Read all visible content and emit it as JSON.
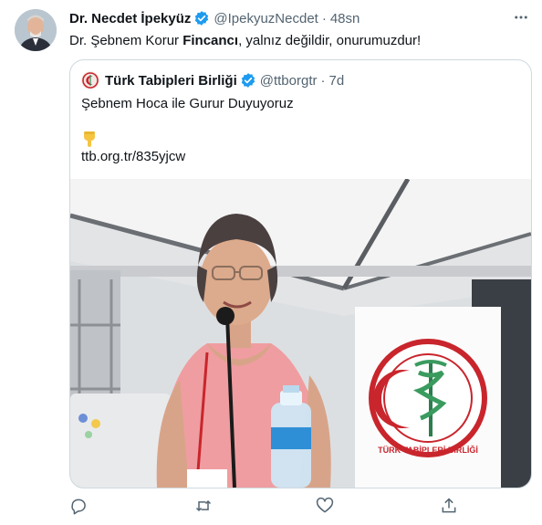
{
  "tweet": {
    "author_name": "Dr. Necdet İpekyüz",
    "handle": "@IpekyuzNecdet",
    "separator": "·",
    "time": "48sn",
    "text_before": "Dr. Şebnem Korur ",
    "text_bold": "Fincancı",
    "text_after": ", yalnız değildir, onurumuzdur!",
    "more_icon": "ellipsis-icon"
  },
  "quote": {
    "author_name": "Türk Tabipleri Birliği",
    "handle": "@ttborgtr",
    "separator": "·",
    "time": "7d",
    "text": "Şebnem Hoca ile Gurur Duyuyoruz",
    "emoji": "pointing-down-hand",
    "link": "ttb.org.tr/835yjcw",
    "banner_text": "TÜRK TABİPLERİ BİRLİĞİ"
  },
  "actions": [
    "reply-icon",
    "retweet-icon",
    "like-icon",
    "share-icon"
  ],
  "colors": {
    "verified": "#1d9bf0",
    "secondary": "#536471",
    "border": "#cfd9de"
  }
}
